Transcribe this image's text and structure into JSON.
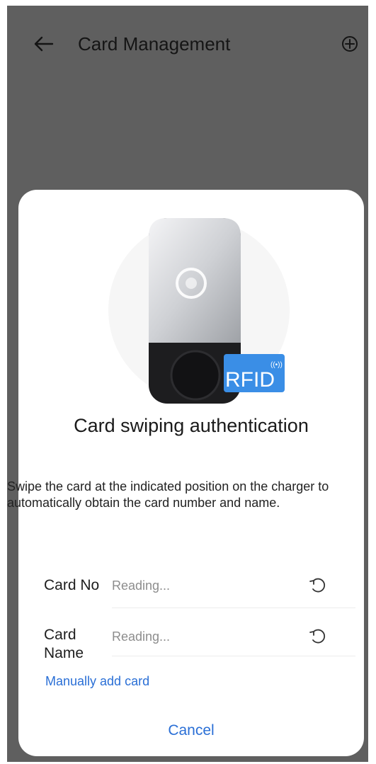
{
  "header": {
    "title": "Card Management"
  },
  "dialog": {
    "heading": "Card swiping authentication",
    "description": "Swipe the card at the indicated position on the charger to automatically obtain the card number and name.",
    "rfid_label": "RFID",
    "fields": [
      {
        "label": "Card No",
        "value": "Reading..."
      },
      {
        "label_lines": [
          "Card",
          "Name"
        ],
        "value": "Reading..."
      }
    ],
    "manual_link": "Manually add card",
    "cancel_label": "Cancel"
  },
  "colors": {
    "overlay": "#5f5f5f",
    "accent": "#2a6fd6",
    "rfid_card": "#3a8ee6"
  },
  "icons": {
    "back": "arrow-left-icon",
    "add": "plus-circle-icon",
    "refresh": "refresh-icon"
  }
}
